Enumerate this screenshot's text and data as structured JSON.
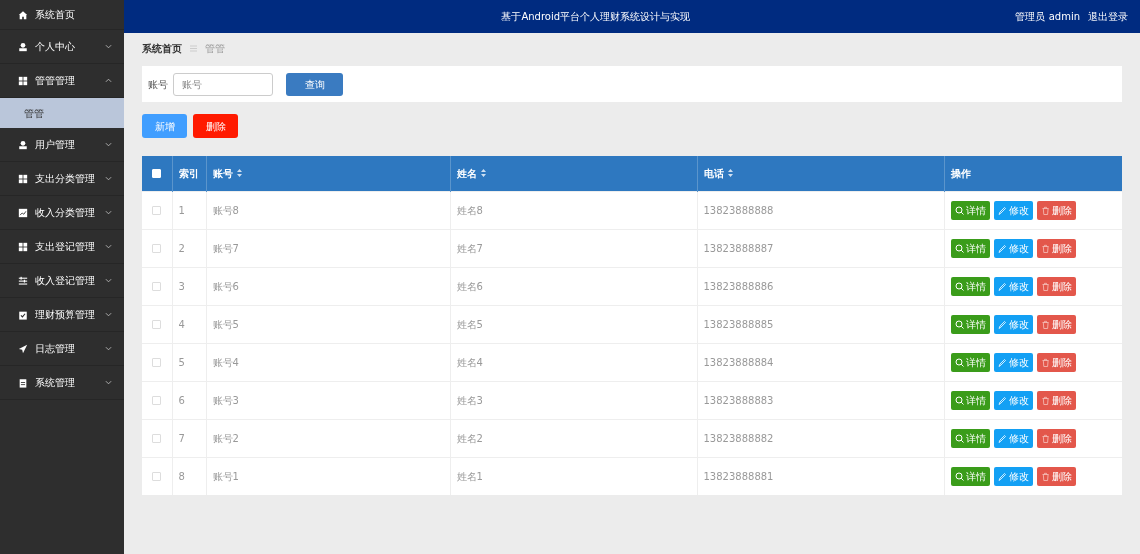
{
  "header": {
    "title": "基于Android平台个人理财系统设计与实现",
    "user": "管理员 admin",
    "logout": "退出登录"
  },
  "sidebar": {
    "items": [
      {
        "label": "系统首页"
      },
      {
        "label": "个人中心",
        "expanded": false
      },
      {
        "label": "管管管理",
        "expanded": true,
        "children": [
          {
            "label": "管管",
            "selected": true
          }
        ]
      },
      {
        "label": "用户管理",
        "expanded": false
      },
      {
        "label": "支出分类管理",
        "expanded": false
      },
      {
        "label": "收入分类管理",
        "expanded": false
      },
      {
        "label": "支出登记管理",
        "expanded": false
      },
      {
        "label": "收入登记管理",
        "expanded": false
      },
      {
        "label": "理财预算管理",
        "expanded": false
      },
      {
        "label": "日志管理",
        "expanded": false
      },
      {
        "label": "系统管理",
        "expanded": false
      }
    ]
  },
  "breadcrumb": [
    "系统首页",
    "管管"
  ],
  "search": {
    "label": "账号",
    "placeholder": "账号",
    "button": "查询"
  },
  "actions": [
    "新增",
    "删除"
  ],
  "table": {
    "select_all": false,
    "columns": [
      "索引",
      "账号",
      "姓名",
      "电话",
      "操作"
    ],
    "rows": [
      {
        "checked": false,
        "cells": [
          "1",
          "账号8",
          "姓名8",
          "13823888888"
        ],
        "actions": [
          "详情",
          "修改",
          "删除"
        ]
      },
      {
        "checked": false,
        "cells": [
          "2",
          "账号7",
          "姓名7",
          "13823888887"
        ],
        "actions": [
          "详情",
          "修改",
          "删除"
        ]
      },
      {
        "checked": false,
        "cells": [
          "3",
          "账号6",
          "姓名6",
          "13823888886"
        ],
        "actions": [
          "详情",
          "修改",
          "删除"
        ]
      },
      {
        "checked": false,
        "cells": [
          "4",
          "账号5",
          "姓名5",
          "13823888885"
        ],
        "actions": [
          "详情",
          "修改",
          "删除"
        ]
      },
      {
        "checked": false,
        "cells": [
          "5",
          "账号4",
          "姓名4",
          "13823888884"
        ],
        "actions": [
          "详情",
          "修改",
          "删除"
        ]
      },
      {
        "checked": false,
        "cells": [
          "6",
          "账号3",
          "姓名3",
          "13823888883"
        ],
        "actions": [
          "详情",
          "修改",
          "删除"
        ]
      },
      {
        "checked": false,
        "cells": [
          "7",
          "账号2",
          "姓名2",
          "13823888882"
        ],
        "actions": [
          "详情",
          "修改",
          "删除"
        ]
      },
      {
        "checked": false,
        "cells": [
          "8",
          "账号1",
          "姓名1",
          "13823888881"
        ],
        "actions": [
          "详情",
          "修改",
          "删除"
        ]
      }
    ]
  }
}
